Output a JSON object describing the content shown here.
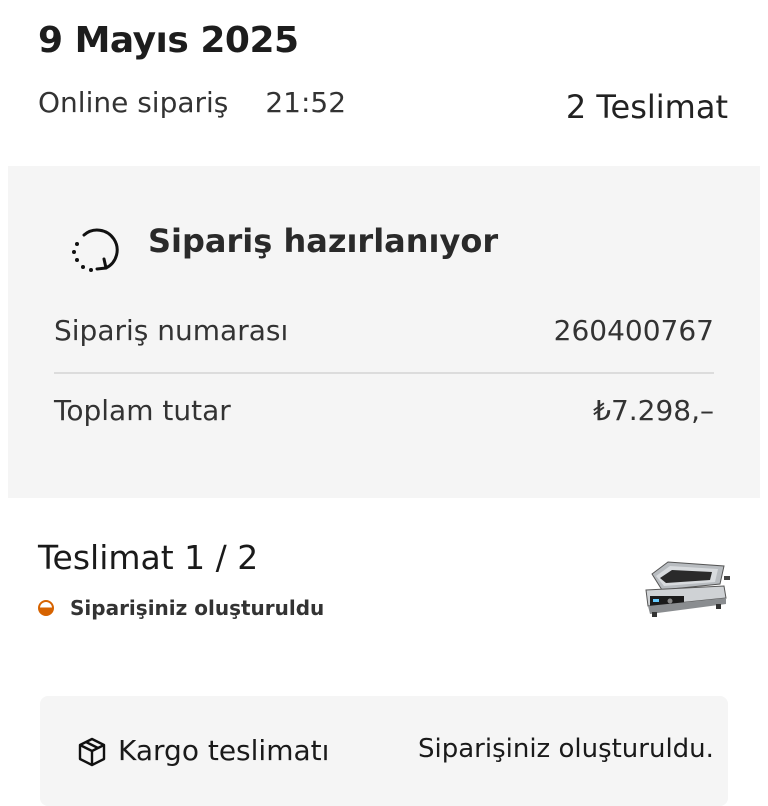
{
  "header": {
    "date": "9 Mayıs 2025",
    "order_type": "Online sipariş",
    "time": "21:52",
    "delivery_count": "2 Teslimat"
  },
  "status_card": {
    "icon": "progress-refresh-icon",
    "title": "Sipariş hazırlanıyor",
    "order_number_label": "Sipariş numarası",
    "order_number": "260400767",
    "total_label": "Toplam tutar",
    "total_value": "₺7.298,–"
  },
  "delivery": {
    "title": "Teslimat 1 / 2",
    "status": "Siparişiniz oluşturuldu",
    "status_color": "#d66300",
    "product_image": "contact-grill-product-image"
  },
  "shipping": {
    "icon": "package-icon",
    "label": "Kargo teslimatı",
    "status": "Siparişiniz oluşturuldu."
  }
}
